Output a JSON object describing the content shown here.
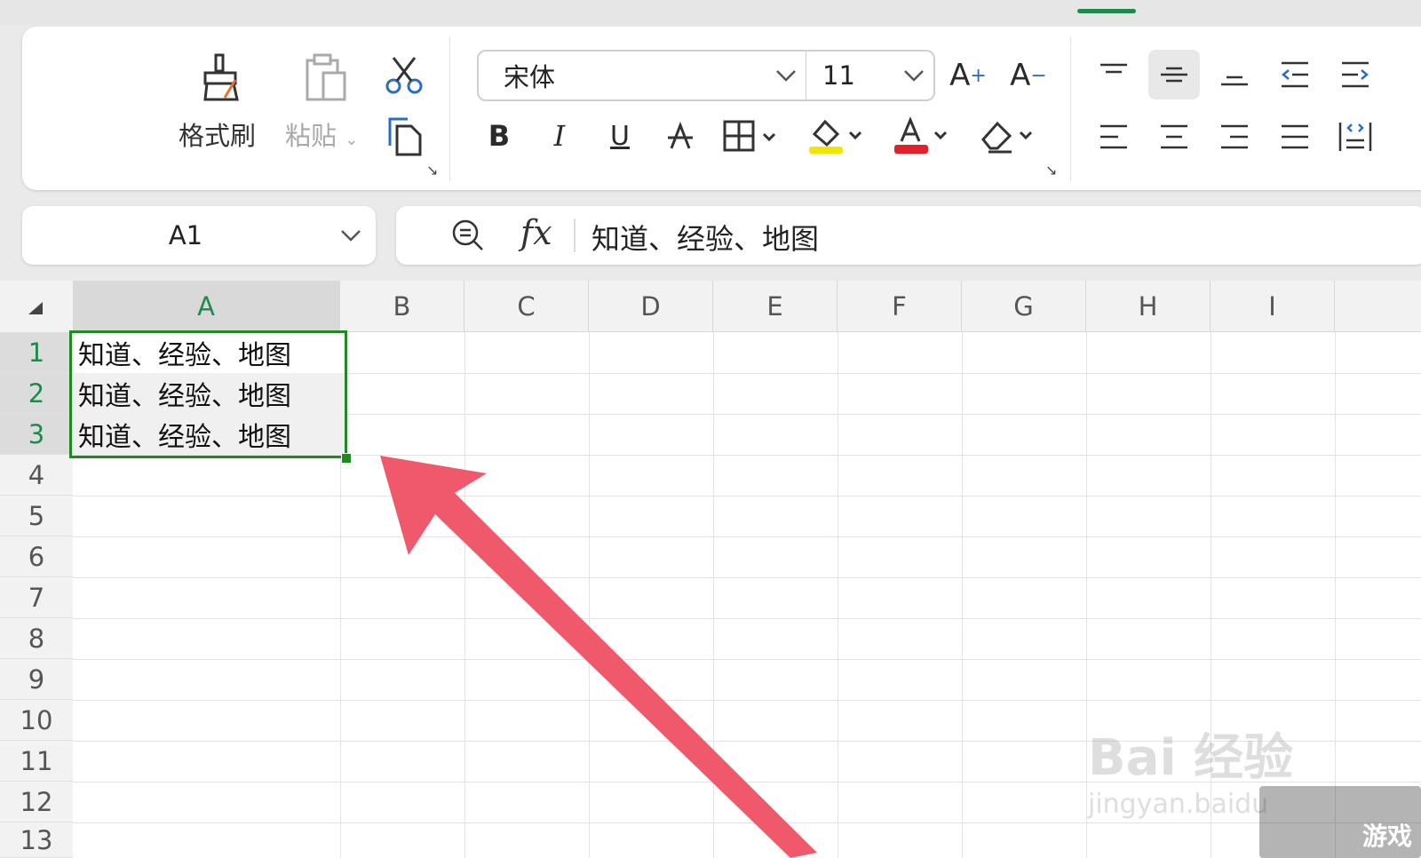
{
  "ribbon": {
    "format_painter": "格式刷",
    "paste": "粘贴",
    "font_name": "宋体",
    "font_size": "11",
    "bold": "B",
    "italic": "I",
    "underline": "U"
  },
  "name_box": "A1",
  "formula": "知道、经验、地图",
  "columns": [
    "A",
    "B",
    "C",
    "D",
    "E",
    "F",
    "G",
    "H",
    "I"
  ],
  "rows": [
    "1",
    "2",
    "3",
    "4",
    "5",
    "6",
    "7",
    "8",
    "9",
    "10",
    "11",
    "12",
    "13"
  ],
  "cells": [
    "知道、经验、地图",
    "知道、经验、地图",
    "知道、经验、地图"
  ],
  "selected_column": "A",
  "selected_rows": [
    "1",
    "2",
    "3"
  ],
  "colors": {
    "accent": "#1f8a4c",
    "highlight": "#f2e600",
    "font_color": "#e0202b",
    "arrow": "#f0596b"
  },
  "watermark": {
    "text": "Bai 经验",
    "sub": "jingyan.baidu",
    "badge": "游戏"
  }
}
